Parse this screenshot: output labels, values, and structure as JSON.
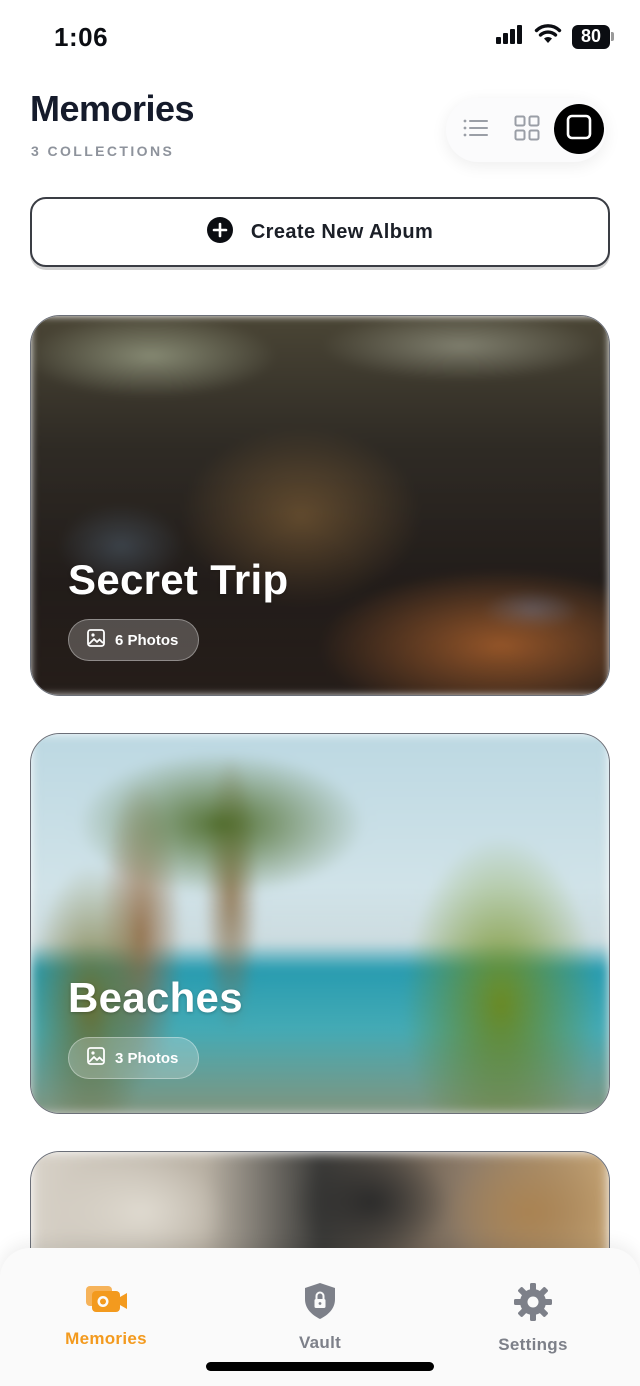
{
  "status_bar": {
    "time": "1:06",
    "battery_level": "80",
    "signal_icon": "signal-bars-icon",
    "wifi_icon": "wifi-icon"
  },
  "header": {
    "title": "Memories",
    "subtitle": "3 COLLECTIONS"
  },
  "view_switcher": {
    "options": [
      {
        "icon": "list-view-icon",
        "selected": false
      },
      {
        "icon": "grid-view-icon",
        "selected": false
      },
      {
        "icon": "single-view-icon",
        "selected": true
      }
    ]
  },
  "create_album": {
    "label": "Create New Album",
    "icon": "plus-circle-icon"
  },
  "albums": [
    {
      "title": "Secret Trip",
      "count_label": "6 Photos"
    },
    {
      "title": "Beaches",
      "count_label": "3 Photos"
    },
    {
      "title": "",
      "count_label": ""
    }
  ],
  "tab_bar": {
    "tabs": [
      {
        "label": "Memories",
        "icon": "photos-icon",
        "active": true
      },
      {
        "label": "Vault",
        "icon": "shield-lock-icon",
        "active": false
      },
      {
        "label": "Settings",
        "icon": "gear-icon",
        "active": false
      }
    ]
  },
  "colors": {
    "accent": "#f39a1e",
    "title": "#151b2b",
    "muted": "#8e939c",
    "inactive_tab": "#7d8089"
  }
}
